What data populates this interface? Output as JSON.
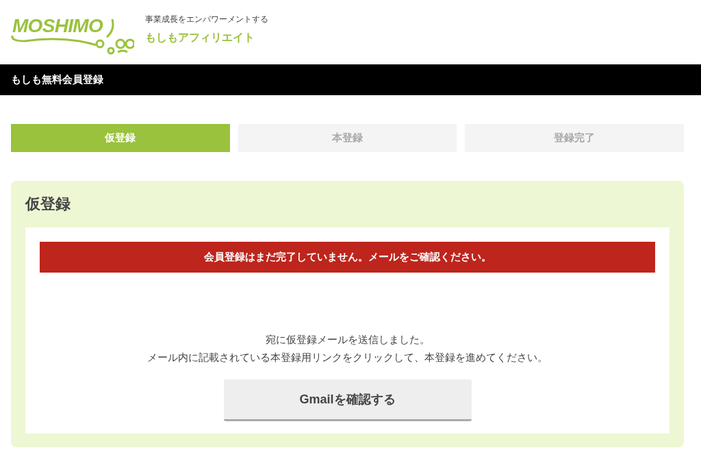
{
  "header": {
    "logo": "MOSHIMO",
    "tagline": "事業成長をエンパワーメントする",
    "site_name": "もしもアフィリエイト"
  },
  "title_bar": "もしも無料会員登録",
  "steps": [
    {
      "label": "仮登録",
      "selected": true
    },
    {
      "label": "本登録",
      "selected": false
    },
    {
      "label": "登録完了",
      "selected": false
    }
  ],
  "panel": {
    "title": "仮登録",
    "alert": "会員登録はまだ完了していません。メールをご確認ください。",
    "messages": [
      "宛に仮登録メールを送信しました。",
      "メール内に記載されている本登録用リンクをクリックして、本登録を進めてください。"
    ],
    "button": "Gmailを確認する"
  }
}
